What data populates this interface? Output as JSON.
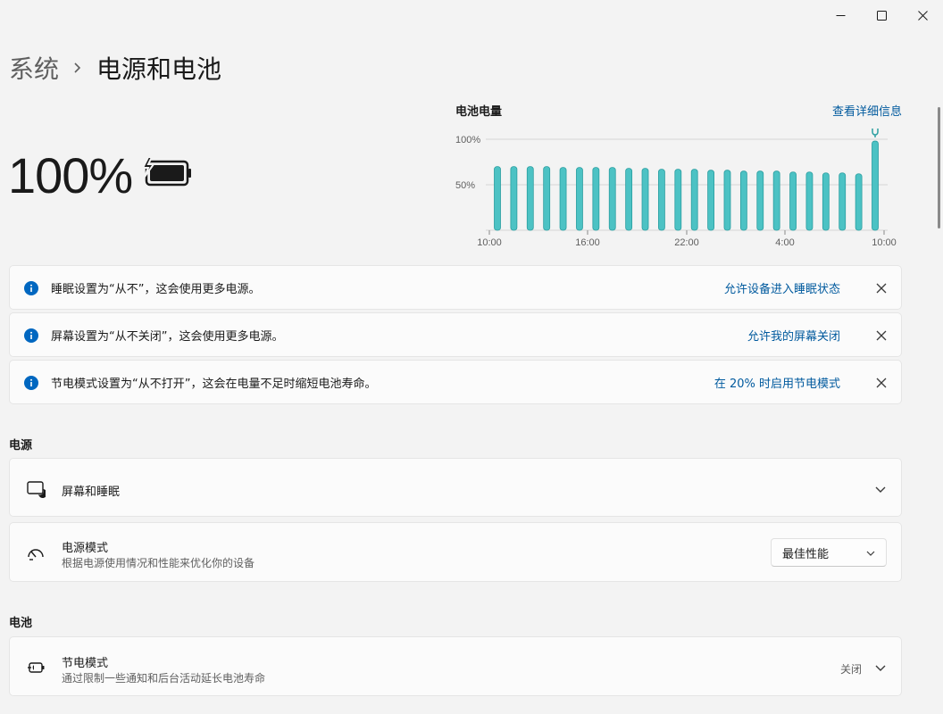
{
  "breadcrumb": {
    "parent": "系统",
    "current": "电源和电池"
  },
  "battery": {
    "percent_text": "100%",
    "icon": "battery-charging-icon"
  },
  "chart_data": {
    "type": "bar",
    "title": "电池电量",
    "link": "查看详细信息",
    "y_ticks": [
      "100%",
      "50%"
    ],
    "x_ticks": [
      "10:00",
      "16:00",
      "22:00",
      "4:00",
      "10:00"
    ],
    "ylim": [
      0,
      100
    ],
    "values": [
      70,
      70,
      70,
      70,
      69,
      69,
      69,
      69,
      68,
      68,
      67,
      67,
      67,
      66,
      66,
      65,
      65,
      65,
      64,
      64,
      63,
      63,
      62,
      98
    ],
    "bar_color": "#4cc2c4",
    "plug_marker_on_last": true
  },
  "notices": [
    {
      "text": "睡眠设置为“从不”，这会使用更多电源。",
      "action": "允许设备进入睡眠状态"
    },
    {
      "text": "屏幕设置为“从不关闭”，这会使用更多电源。",
      "action": "允许我的屏幕关闭"
    },
    {
      "text": "节电模式设置为“从不打开”，这会在电量不足时缩短电池寿命。",
      "action": "在 20% 时启用节电模式"
    }
  ],
  "sections": {
    "power": "电源",
    "battery": "电池"
  },
  "cards": {
    "screen_sleep": {
      "title": "屏幕和睡眠"
    },
    "power_mode": {
      "title": "电源模式",
      "desc": "根据电源使用情况和性能来优化你的设备",
      "value": "最佳性能"
    },
    "battery_saver": {
      "title": "节电模式",
      "desc": "通过限制一些通知和后台活动延长电池寿命",
      "status": "关闭"
    }
  },
  "colors": {
    "accent": "#005a9e",
    "info": "#0067c0",
    "bar": "#4cc2c4"
  }
}
